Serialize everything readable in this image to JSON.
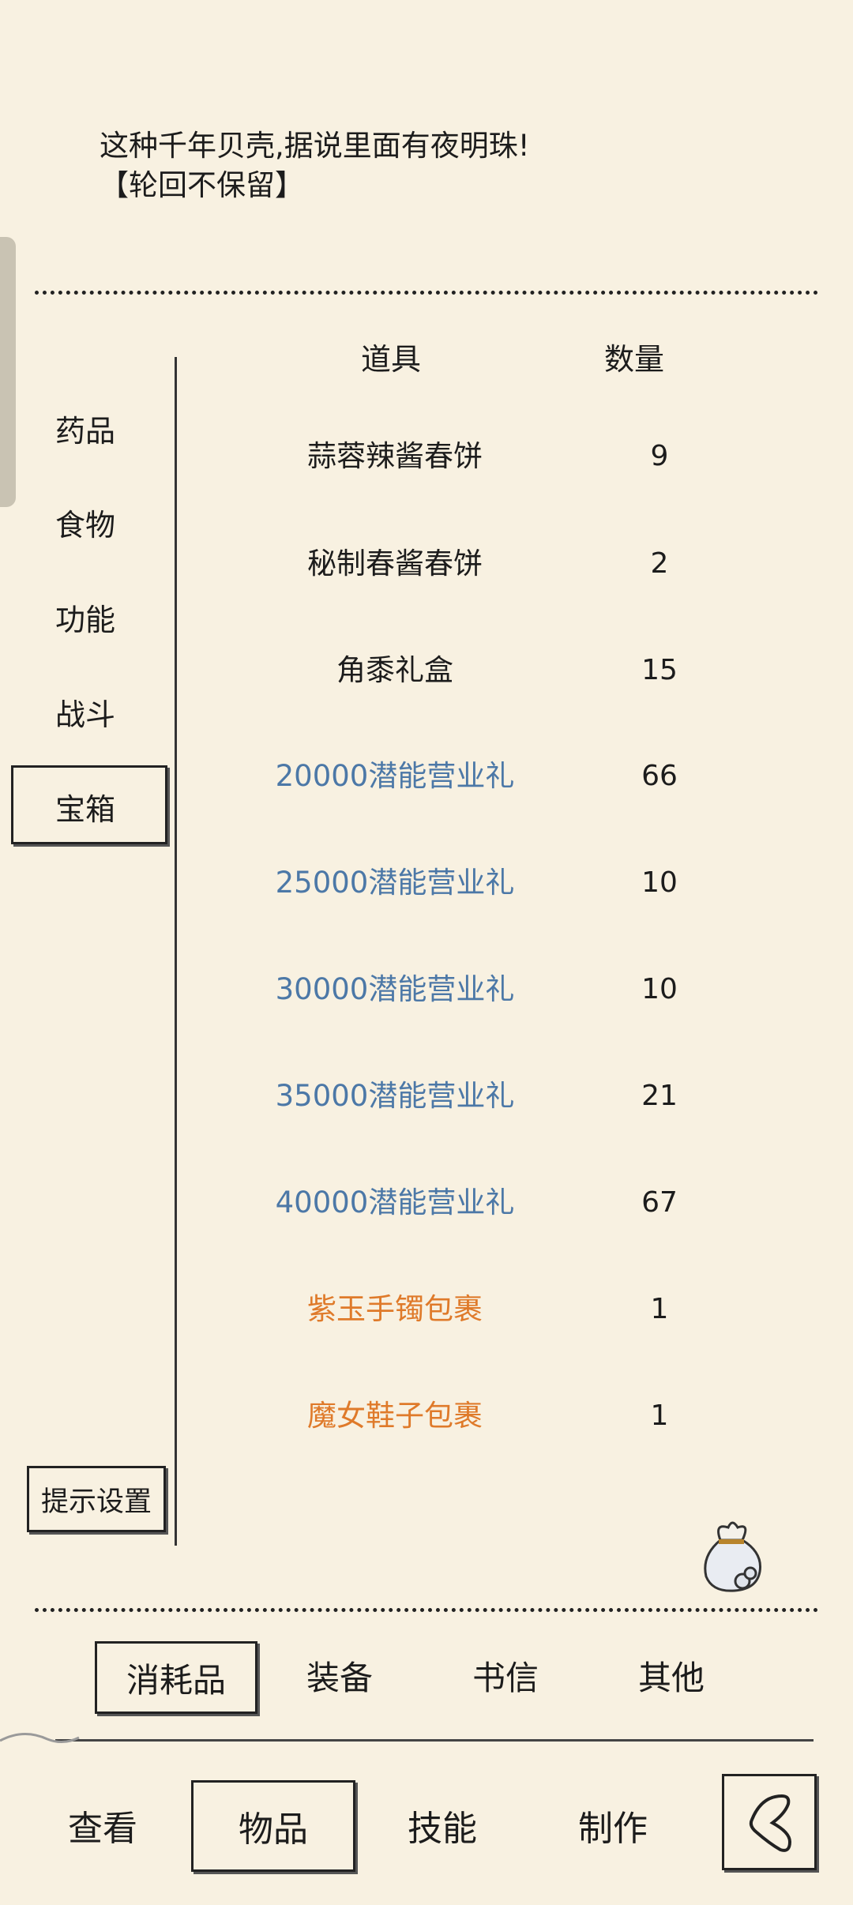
{
  "description": {
    "line1": "这种千年贝壳,据说里面有夜明珠!",
    "line2": "【轮回不保留】"
  },
  "categories": [
    {
      "label": "药品"
    },
    {
      "label": "食物"
    },
    {
      "label": "功能"
    },
    {
      "label": "战斗"
    },
    {
      "label": "宝箱"
    }
  ],
  "selected_category": "宝箱",
  "table": {
    "header_item": "道具",
    "header_qty": "数量",
    "rows": [
      {
        "name": "蒜蓉辣酱春饼",
        "qty": "9",
        "color": "#1c1c1c"
      },
      {
        "name": "秘制春酱春饼",
        "qty": "2",
        "color": "#1c1c1c"
      },
      {
        "name": "角黍礼盒",
        "qty": "15",
        "color": "#1c1c1c"
      },
      {
        "name": "20000潜能营业礼",
        "qty": "66",
        "color": "#4c78a7"
      },
      {
        "name": "25000潜能营业礼",
        "qty": "10",
        "color": "#4c78a7"
      },
      {
        "name": "30000潜能营业礼",
        "qty": "10",
        "color": "#4c78a7"
      },
      {
        "name": "35000潜能营业礼",
        "qty": "21",
        "color": "#4c78a7"
      },
      {
        "name": "40000潜能营业礼",
        "qty": "67",
        "color": "#4c78a7"
      },
      {
        "name": "紫玉手镯包裹",
        "qty": "1",
        "color": "#df7a2a"
      },
      {
        "name": "魔女鞋子包裹",
        "qty": "1",
        "color": "#df7a2a"
      }
    ]
  },
  "hint_settings_label": "提示设置",
  "sub_tabs": [
    {
      "label": "消耗品"
    },
    {
      "label": "装备"
    },
    {
      "label": "书信"
    },
    {
      "label": "其他"
    }
  ],
  "selected_sub_tab": "消耗品",
  "bottom_nav": [
    {
      "label": "查看"
    },
    {
      "label": "物品"
    },
    {
      "label": "技能"
    },
    {
      "label": "制作"
    }
  ],
  "selected_bottom_nav": "物品",
  "icons": {
    "bag": "bag-icon",
    "back": "back-icon"
  }
}
